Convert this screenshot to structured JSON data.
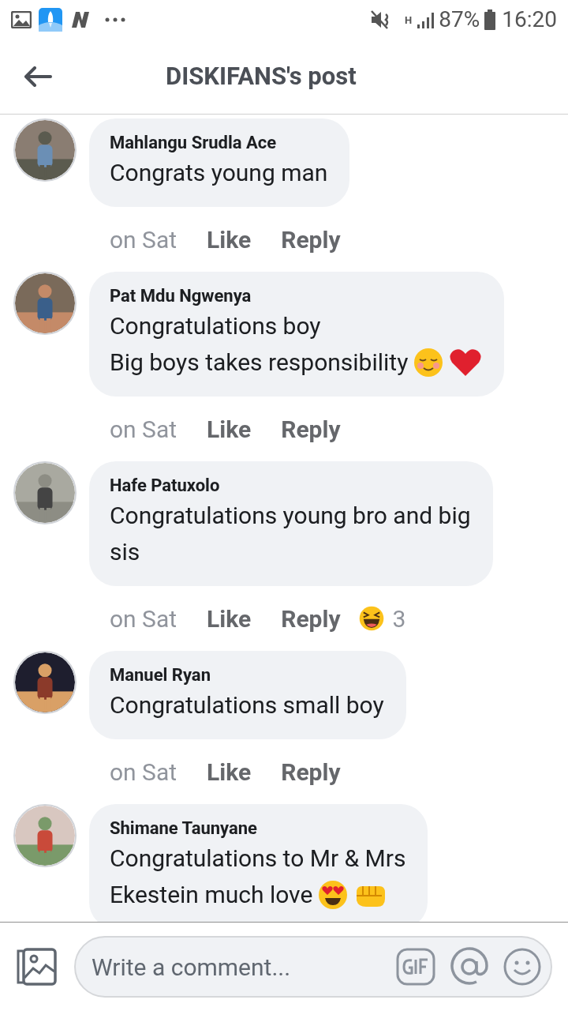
{
  "status_bar": {
    "network": "H",
    "battery": "87%",
    "time": "16:20"
  },
  "header": {
    "title": "DISKIFANS's post"
  },
  "comments": [
    {
      "author": "Mahlangu Srudla Ace",
      "lines": [
        "Congrats young man"
      ],
      "time": "on Sat",
      "like": "Like",
      "reply": "Reply"
    },
    {
      "author": "Pat Mdu Ngwenya",
      "lines": [
        "Congratulations boy",
        "Big boys takes responsibility"
      ],
      "emojis": [
        {
          "kind": "blush"
        },
        {
          "kind": "heart"
        }
      ],
      "time": "on Sat",
      "like": "Like",
      "reply": "Reply"
    },
    {
      "author": "Hafe Patuxolo",
      "lines": [
        "Congratulations young bro and big",
        "sis"
      ],
      "time": "on Sat",
      "like": "Like",
      "reply": "Reply",
      "reaction": {
        "kind": "laugh",
        "count": "3"
      }
    },
    {
      "author": "Manuel Ryan",
      "lines": [
        "Congratulations small boy"
      ],
      "time": "on Sat",
      "like": "Like",
      "reply": "Reply"
    },
    {
      "author": "Shimane Taunyane",
      "lines": [
        "Congratulations to Mr & Mrs",
        "Ekestein much love"
      ],
      "emojis": [
        {
          "kind": "heart-eyes"
        },
        {
          "kind": "fist"
        }
      ]
    }
  ],
  "composer": {
    "placeholder": "Write a comment..."
  }
}
